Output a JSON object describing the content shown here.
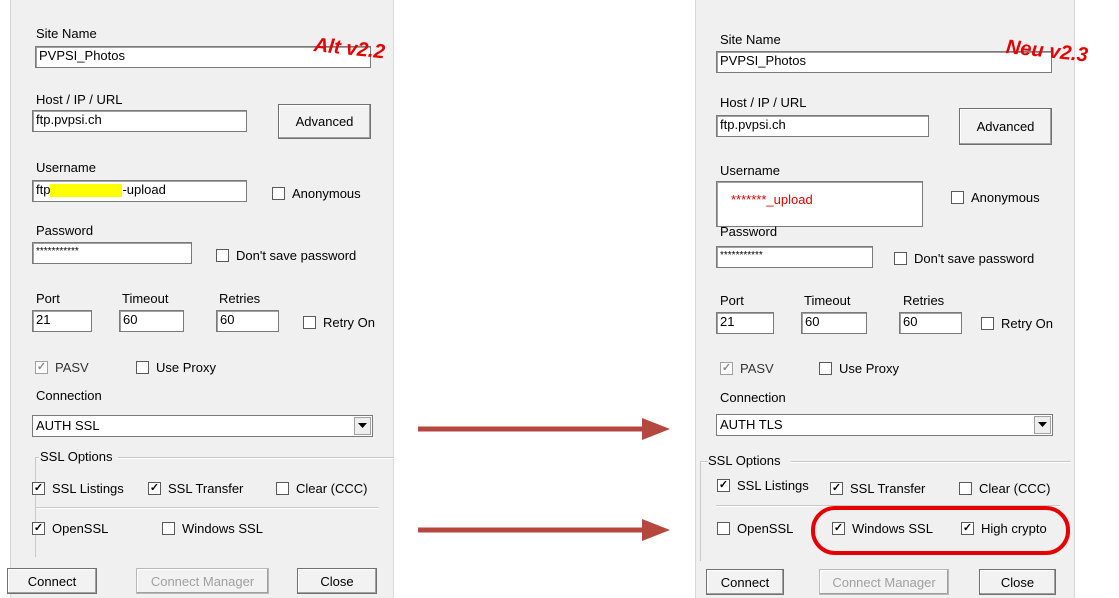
{
  "old": {
    "version_tag": "Alt v2.2",
    "site_name_label": "Site Name",
    "site_name_value": "PVPSI_Photos",
    "host_label": "Host / IP / URL",
    "host_value": "ftp.pvpsi.ch",
    "advanced_label": "Advanced",
    "username_label": "Username",
    "username_prefix": "ftp",
    "username_suffix": "-upload",
    "anonymous_label": "Anonymous",
    "password_label": "Password",
    "password_value": "***********",
    "dont_save_label": "Don't save password",
    "port_label": "Port",
    "port_value": "21",
    "timeout_label": "Timeout",
    "timeout_value": "60",
    "retries_label": "Retries",
    "retries_value": "60",
    "retry_on_label": "Retry On",
    "pasv_label": "PASV",
    "use_proxy_label": "Use Proxy",
    "connection_label": "Connection",
    "connection_value": "AUTH SSL",
    "ssl_options_label": "SSL Options",
    "ssl_listings_label": "SSL Listings",
    "ssl_transfer_label": "SSL Transfer",
    "clear_ccc_label": "Clear (CCC)",
    "openssl_label": "OpenSSL",
    "windows_ssl_label": "Windows SSL",
    "connect_label": "Connect",
    "connect_manager_label": "Connect Manager",
    "close_label": "Close"
  },
  "new": {
    "version_tag": "Neu v2.3",
    "site_name_label": "Site Name",
    "site_name_value": "PVPSI_Photos",
    "host_label": "Host / IP / URL",
    "host_value": "ftp.pvpsi.ch",
    "advanced_label": "Advanced",
    "username_label": "Username",
    "username_value": "*******_upload",
    "anonymous_label": "Anonymous",
    "password_label": "Password",
    "password_value": "***********",
    "dont_save_label": "Don't save password",
    "port_label": "Port",
    "port_value": "21",
    "timeout_label": "Timeout",
    "timeout_value": "60",
    "retries_label": "Retries",
    "retries_value": "60",
    "retry_on_label": "Retry On",
    "pasv_label": "PASV",
    "use_proxy_label": "Use Proxy",
    "connection_label": "Connection",
    "connection_value": "AUTH TLS",
    "ssl_options_label": "SSL Options",
    "ssl_listings_label": "SSL Listings",
    "ssl_transfer_label": "SSL Transfer",
    "clear_ccc_label": "Clear (CCC)",
    "openssl_label": "OpenSSL",
    "windows_ssl_label": "Windows SSL",
    "high_crypto_label": "High crypto",
    "connect_label": "Connect",
    "connect_manager_label": "Connect Manager",
    "close_label": "Close"
  },
  "colors": {
    "annotation_red": "#e60000",
    "arrow_red": "#b5473f",
    "highlight_yellow": "#ffff00"
  },
  "icons": {
    "checkmark": "check-icon",
    "dropdown": "chevron-down-icon",
    "arrow": "right-arrow-icon"
  }
}
